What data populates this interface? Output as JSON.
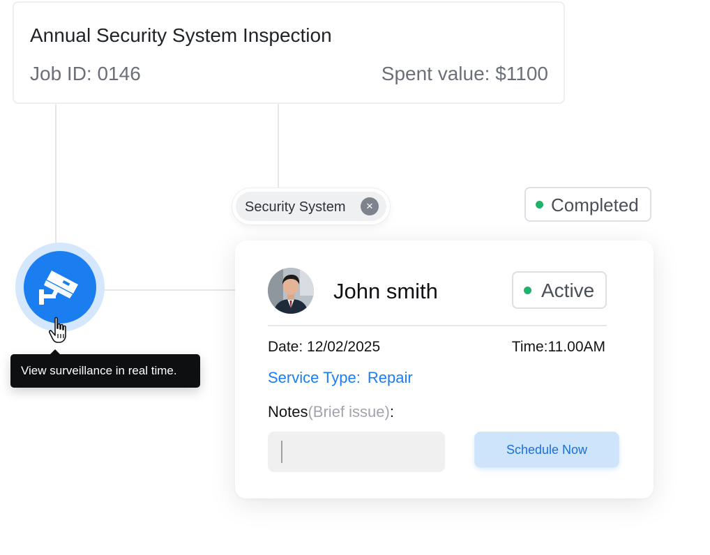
{
  "job": {
    "title": "Annual Security System Inspection",
    "job_id": "Job ID: 0146",
    "spent": "Spent value: $1100"
  },
  "category_chip": {
    "label": "Security System",
    "close_icon": "×"
  },
  "job_status": {
    "label": "Completed",
    "dot_color": "#20b26b"
  },
  "camera": {
    "icon": "cctv-camera-icon",
    "accent": "#1a7ef0",
    "halo": "#d4e7fc"
  },
  "tooltip": {
    "text": "View surveillance in real time."
  },
  "technician": {
    "name": "John smith",
    "status": "Active",
    "date": "Date: 12/02/2025",
    "time": "Time:11.00AM",
    "service_label": "Service Type:",
    "service_value": "Repair",
    "notes_label": "Notes",
    "notes_hint": "(Brief issue)",
    "notes_colon": ":",
    "notes_value": ""
  },
  "actions": {
    "schedule_label": "Schedule Now"
  }
}
